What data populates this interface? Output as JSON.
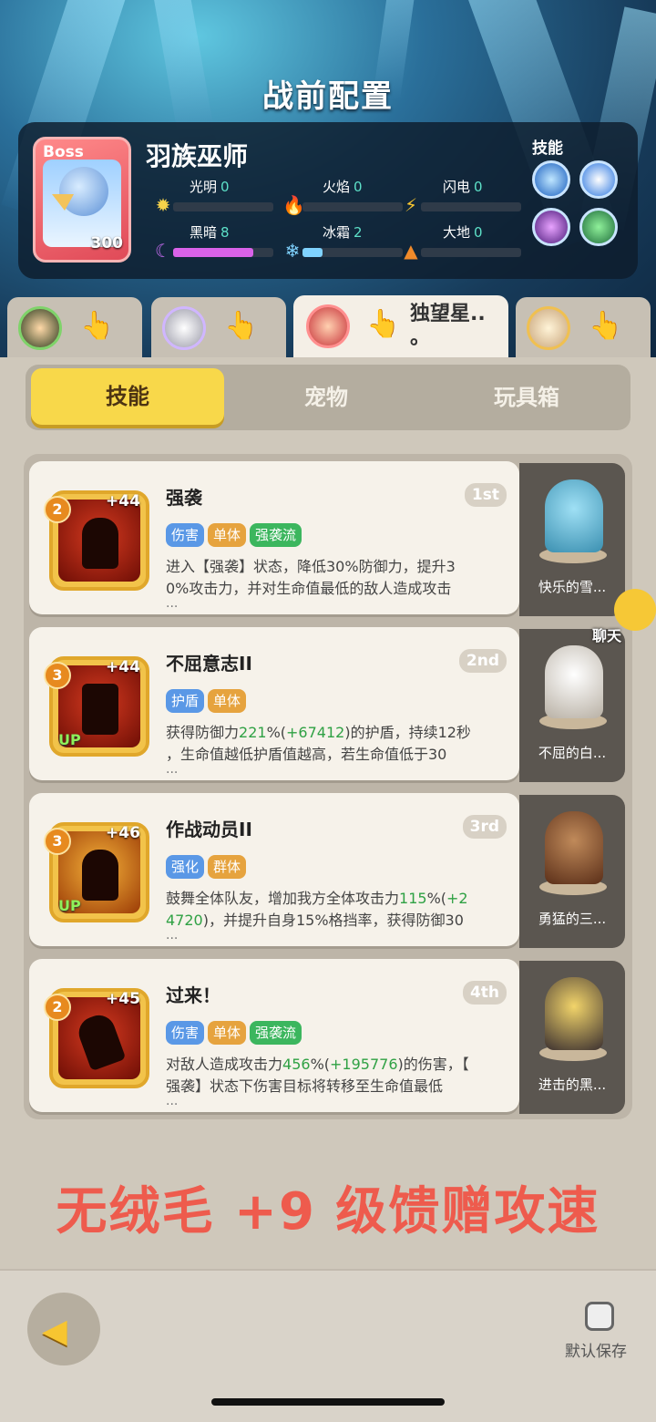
{
  "header": {
    "title": "战前配置"
  },
  "boss": {
    "tag": "Boss",
    "level": "300",
    "name": "羽族巫师",
    "elements": [
      {
        "label": "光明",
        "value": "0"
      },
      {
        "label": "火焰",
        "value": "0"
      },
      {
        "label": "闪电",
        "value": "0"
      },
      {
        "label": "黑暗",
        "value": "8"
      },
      {
        "label": "冰霜",
        "value": "2"
      },
      {
        "label": "大地",
        "value": "0"
      }
    ],
    "skills_label": "技能"
  },
  "hero_tabs": [
    {
      "name": "",
      "active": false
    },
    {
      "name": "",
      "active": false
    },
    {
      "name": "独望星..\n。",
      "active": true
    },
    {
      "name": "",
      "active": false
    }
  ],
  "segments": [
    {
      "label": "技能",
      "active": true
    },
    {
      "label": "宠物",
      "active": false
    },
    {
      "label": "玩具箱",
      "active": false
    }
  ],
  "skills": [
    {
      "level": "2",
      "plus": "+44",
      "up": "",
      "name": "强袭",
      "rank": "1st",
      "tags": [
        {
          "text": "伤害",
          "color": "blue"
        },
        {
          "text": "单体",
          "color": "orange"
        },
        {
          "text": "强袭流",
          "color": "green"
        }
      ],
      "desc_line1": "进入【强袭】状态，降低30%防御力，提升3",
      "desc_line2": "0%攻击力，并对生命值最低的敌人造成攻击",
      "ellipsis": "...",
      "pet": "快乐的雪..."
    },
    {
      "level": "3",
      "plus": "+44",
      "up": "UP",
      "name": "不屈意志II",
      "rank": "2nd",
      "tags": [
        {
          "text": "护盾",
          "color": "blue"
        },
        {
          "text": "单体",
          "color": "orange"
        }
      ],
      "desc_line1_a": "获得防御力",
      "desc_line1_g": "221",
      "desc_line1_b": "%(",
      "desc_line1_g2": "+67412",
      "desc_line1_c": ")的护盾，持续12秒",
      "desc_line2": "，生命值越低护盾值越高，若生命值低于30",
      "ellipsis": "...",
      "pet": "不屈的白..."
    },
    {
      "level": "3",
      "plus": "+46",
      "up": "UP",
      "name": "作战动员II",
      "rank": "3rd",
      "tags": [
        {
          "text": "强化",
          "color": "blue"
        },
        {
          "text": "群体",
          "color": "orange"
        }
      ],
      "desc_line1_a": "鼓舞全体队友，增加我方全体攻击力",
      "desc_line1_g": "115",
      "desc_line1_b": "%(",
      "desc_line1_g2": "+2",
      "desc_line2_g": "4720",
      "desc_line2_b": ")，并提升自身15%格挡率，获得防御30",
      "ellipsis": "...",
      "pet": "勇猛的三..."
    },
    {
      "level": "2",
      "plus": "+45",
      "up": "",
      "name": "过来！",
      "rank": "4th",
      "tags": [
        {
          "text": "伤害",
          "color": "blue"
        },
        {
          "text": "单体",
          "color": "orange"
        },
        {
          "text": "强袭流",
          "color": "green"
        }
      ],
      "desc_line1_a": "对敌人造成攻击力",
      "desc_line1_g": "456",
      "desc_line1_b": "%(",
      "desc_line1_g2": "+195776",
      "desc_line1_c": ")的伤害，【",
      "desc_line2": "强袭】状态下伤害目标将转移至生命值最低",
      "ellipsis": "...",
      "pet": "进击的黑..."
    }
  ],
  "chat": {
    "label": "聊天"
  },
  "promo": "无绒毛 +9 级馈赠攻速",
  "footer": {
    "save_label": "默认保存"
  },
  "colors": {
    "accent_yellow": "#f8d84a",
    "promo_red": "#ee5b4d",
    "green_value": "#2fa144"
  }
}
